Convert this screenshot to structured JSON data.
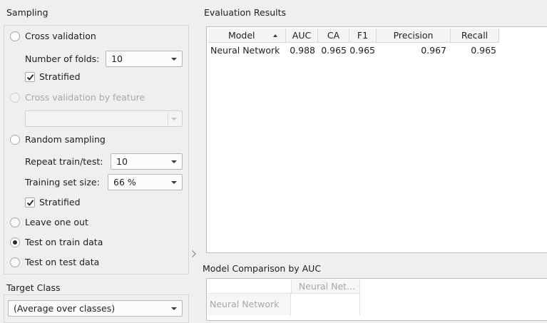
{
  "sampling": {
    "title": "Sampling",
    "cross_validation": {
      "label": "Cross validation",
      "checked": false
    },
    "number_of_folds": {
      "label": "Number of folds:",
      "value": "10"
    },
    "stratified_1": {
      "label": "Stratified",
      "checked": true
    },
    "cross_validation_by_feature": {
      "label": "Cross validation by feature",
      "checked": false,
      "disabled": true
    },
    "feature_combo": {
      "value": ""
    },
    "random_sampling": {
      "label": "Random sampling",
      "checked": false
    },
    "repeat_train_test": {
      "label": "Repeat train/test:",
      "value": "10"
    },
    "training_set_size": {
      "label": "Training set size:",
      "value": "66 %"
    },
    "stratified_2": {
      "label": "Stratified",
      "checked": true
    },
    "leave_one_out": {
      "label": "Leave one out",
      "checked": false
    },
    "test_on_train_data": {
      "label": "Test on train data",
      "checked": true
    },
    "test_on_test_data": {
      "label": "Test on test data",
      "checked": false
    }
  },
  "target_class": {
    "title": "Target Class",
    "value": "(Average over classes)"
  },
  "evaluation": {
    "title": "Evaluation Results",
    "columns": [
      "Model",
      "AUC",
      "CA",
      "F1",
      "Precision",
      "Recall"
    ],
    "rows": [
      [
        "Neural Network",
        "0.988",
        "0.965",
        "0.965",
        "0.967",
        "0.965"
      ]
    ]
  },
  "comparison": {
    "title": "Model Comparison by AUC",
    "column_header": "Neural Net...",
    "row_header": "Neural Network"
  },
  "colors": {
    "background": "#efefef",
    "table_background": "#ffffff",
    "disabled_text": "#a8a8a8"
  }
}
